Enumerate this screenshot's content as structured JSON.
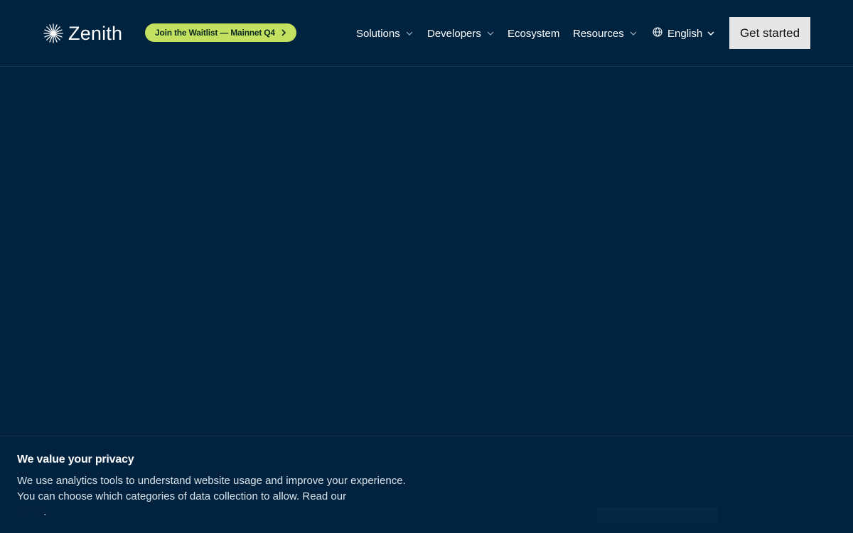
{
  "header": {
    "logo_text": "Zenith",
    "logo_icon": "starburst-icon",
    "waitlist_label": "Join the Waitlist — Mainnet Q4",
    "nav": {
      "solutions": "Solutions",
      "developers": "Developers",
      "ecosystem": "Ecosystem",
      "resources": "Resources",
      "language": "English"
    },
    "cta_label": "Get started"
  },
  "privacy": {
    "title": "We value your privacy",
    "text": "We use analytics tools to understand website usage and improve your experience. You can choose which categories of data collection to allow. Read our",
    "link_text": "",
    "trailing": "."
  },
  "colors": {
    "background": "#002340",
    "accent_pill": "#c4e060",
    "cta_button": "#e6e6e6"
  }
}
